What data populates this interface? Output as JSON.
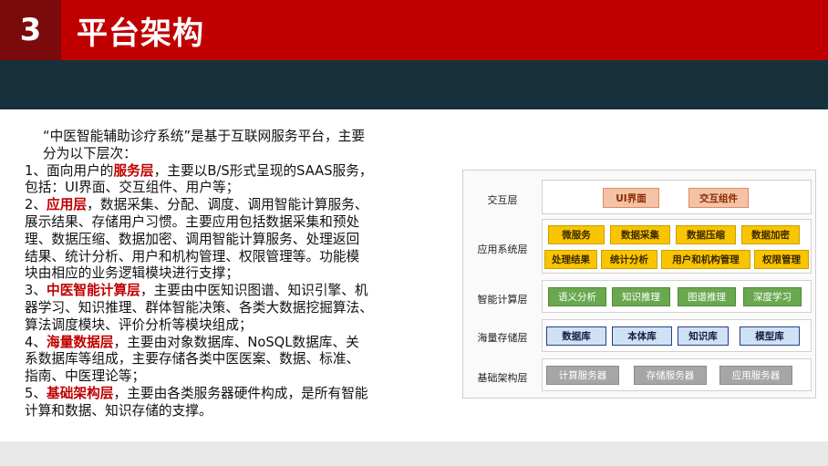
{
  "header": {
    "number": "3",
    "title": "平台架构"
  },
  "text": {
    "intro_l1": "“中医智能辅助诊疗系统”是基于互联网服务平台，主要",
    "intro_l2": "分为以下层次：",
    "p1_pre": "1、面向用户的",
    "p1_hl": "服务层",
    "p1_l1_post": "，主要以B/S形式呈现的SAAS服务，",
    "p1_l2": "包括：UI界面、交互组件、用户等；",
    "p2_pre": "2、",
    "p2_hl": "应用层",
    "p2_l1_post": "，数据采集、分配、调度、调用智能计算服务、",
    "p2_l2": "展示结果、存储用户习惯。主要应用包括数据采集和预处",
    "p2_l3": "理、数据压缩、数据加密、调用智能计算服务、处理返回",
    "p2_l4": "结果、统计分析、用户和机构管理、权限管理等。功能模",
    "p2_l5": "块由相应的业务逻辑模块进行支撑；",
    "p3_pre": "3、",
    "p3_hl": "中医智能计算层",
    "p3_l1_post": "，主要由中医知识图谱、知识引擎、机",
    "p3_l2": "器学习、知识推理、群体智能决策、各类大数据挖掘算法、",
    "p3_l3": "算法调度模块、评价分析等模块组成；",
    "p4_pre": "4、",
    "p4_hl": "海量数据层",
    "p4_l1_post": "，主要由对象数据库、NoSQL数据库、关",
    "p4_l2": "系数据库等组成，主要存储各类中医医案、数据、标准、",
    "p4_l3": "指南、中医理论等；",
    "p5_pre": "5、",
    "p5_hl": "基础架构层",
    "p5_l1_post": "，主要由各类服务器硬件构成，是所有智能",
    "p5_l2": "计算和数据、知识存储的支撑。"
  },
  "diagram": {
    "layers": [
      {
        "label": "交互层",
        "items": [
          "UI界面",
          "交互组件"
        ]
      },
      {
        "label": "应用系统层",
        "items": [
          "微服务",
          "数据采集",
          "数据压缩",
          "数据加密",
          "处理结果",
          "统计分析",
          "用户和机构管理",
          "权限管理"
        ]
      },
      {
        "label": "智能计算层",
        "items": [
          "语义分析",
          "知识推理",
          "图谱推理",
          "深度学习"
        ]
      },
      {
        "label": "海量存储层",
        "items": [
          "数据库",
          "本体库",
          "知识库",
          "模型库"
        ]
      },
      {
        "label": "基础架构层",
        "items": [
          "计算服务器",
          "存储服务器",
          "应用服务器"
        ]
      }
    ]
  },
  "colors": {
    "accent_red": "#c00000",
    "dark_red": "#7b0a0a",
    "dark_teal": "#17313c"
  }
}
